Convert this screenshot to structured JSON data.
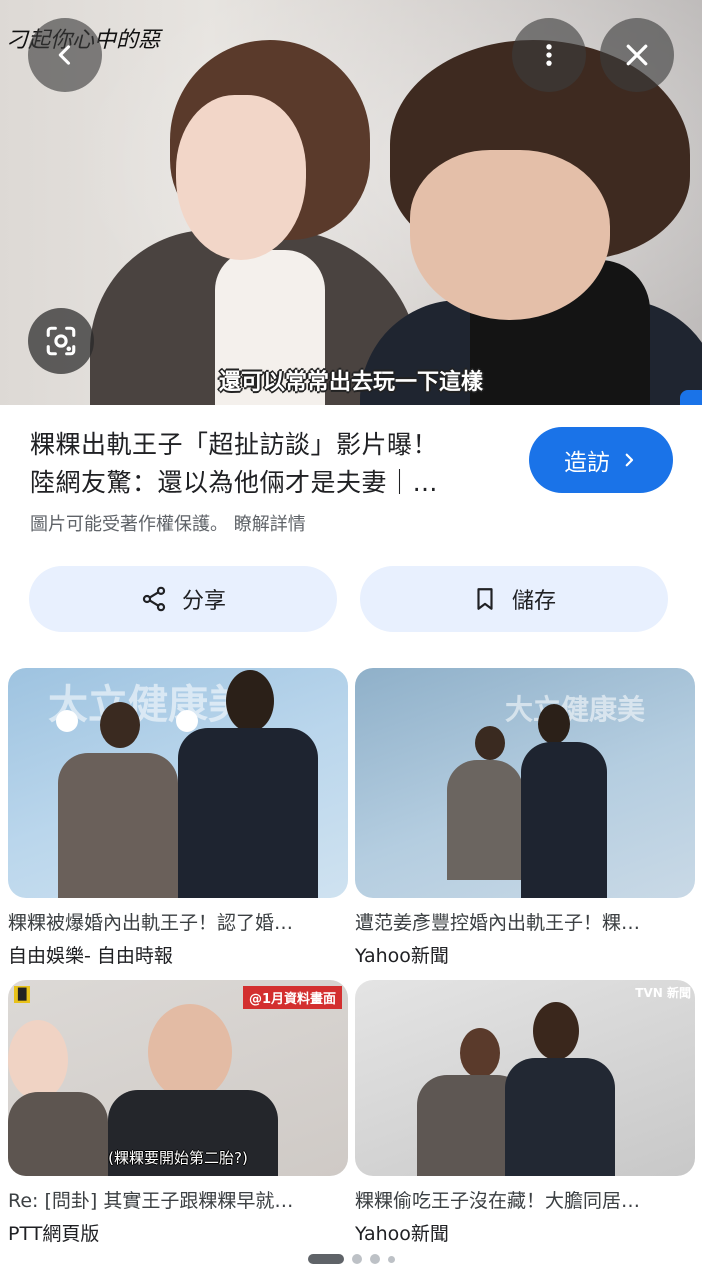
{
  "hero": {
    "watermark": "刁起你心中的惡",
    "subtitle": "還可以常常出去玩一下這樣"
  },
  "icons": {
    "back": "chevron-left-icon",
    "more": "more-vert-icon",
    "close": "close-icon",
    "lens": "google-lens-icon",
    "visit": "chevron-right-icon",
    "share": "share-icon",
    "save": "bookmark-icon"
  },
  "info": {
    "title_line1": "粿粿出軌王子「超扯訪談」影片曝！",
    "title_line2": "陸網友驚：還以為他倆才是夫妻｜…",
    "visit_label": "造訪",
    "copyright_notice": "圖片可能受著作權保護。",
    "learn_more": "瞭解詳情"
  },
  "actions": {
    "share_label": "分享",
    "save_label": "儲存"
  },
  "related": [
    {
      "caption": "粿粿被爆婚內出軌王子！認了婚…",
      "source": "自由娛樂- 自由時報",
      "bg_text": "大立健康美"
    },
    {
      "caption": "遭范姜彥豐控婚內出軌王子！粿…",
      "source": "Yahoo新聞",
      "bg_text": "大立健康美"
    },
    {
      "caption": "Re: [問卦] 其實王子跟粿粿早就…",
      "source": "PTT網頁版",
      "tag": "@1月資料畫面",
      "thumb_subtitle": "(粿粿要開始第二胎?)"
    },
    {
      "caption": "粿粿偷吃王子沒在藏！大膽同居…",
      "source": "Yahoo新聞",
      "logo": "TVN 新聞"
    }
  ],
  "colors": {
    "accent": "#1a73e8",
    "action_bg": "#e8f0fe",
    "secondary_text": "#5f6368"
  }
}
